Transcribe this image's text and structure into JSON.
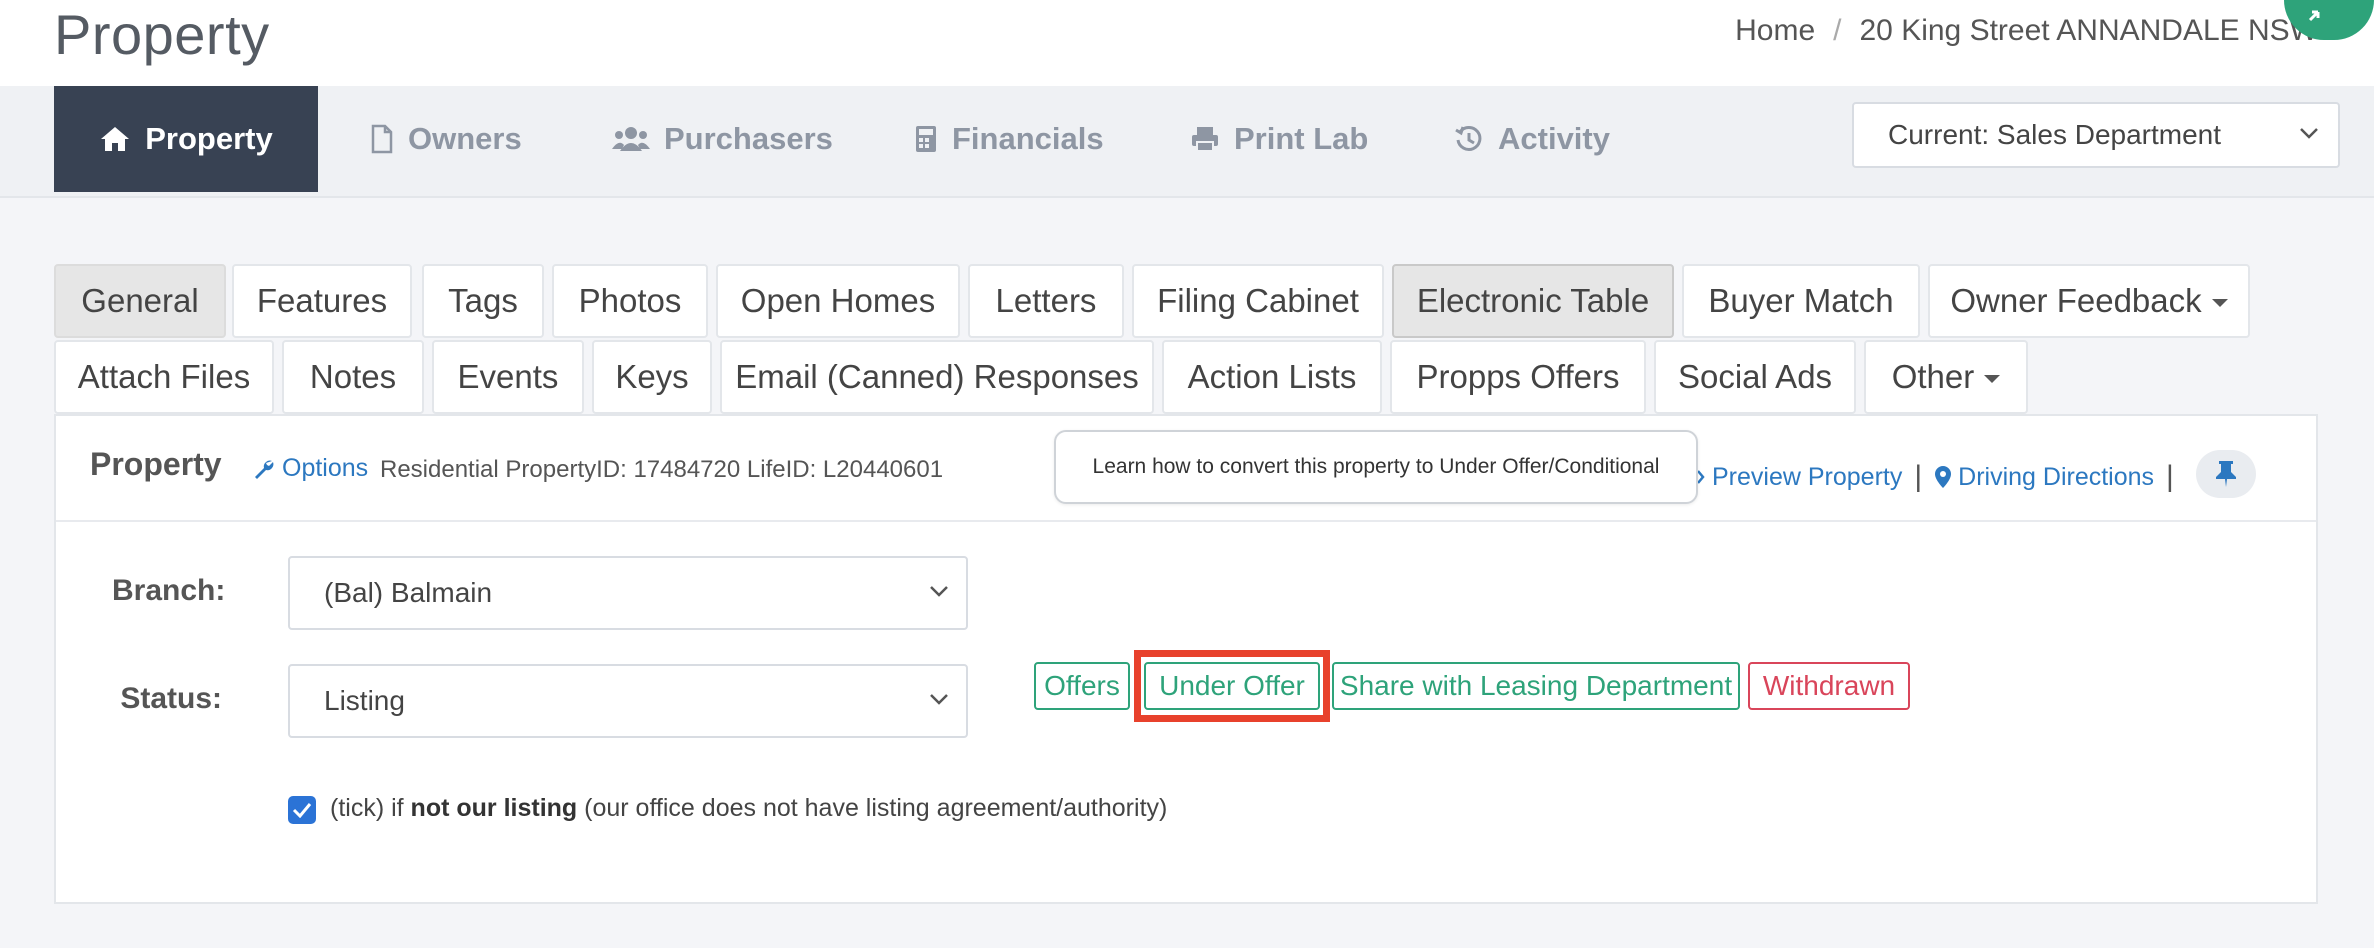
{
  "header": {
    "title": "Property",
    "breadcrumb": {
      "home": "Home",
      "separator": "/",
      "current": "20 King Street ANNANDALE NSW"
    }
  },
  "mainnav": {
    "items": [
      {
        "label": "Property",
        "icon": "home-icon",
        "active": true
      },
      {
        "label": "Owners",
        "icon": "file-icon"
      },
      {
        "label": "Purchasers",
        "icon": "users-icon"
      },
      {
        "label": "Financials",
        "icon": "calculator-icon"
      },
      {
        "label": "Print Lab",
        "icon": "print-icon"
      },
      {
        "label": "Activity",
        "icon": "history-icon"
      }
    ],
    "department": "Current: Sales Department"
  },
  "subtabs": {
    "row1": [
      "General",
      "Features",
      "Tags",
      "Photos",
      "Open Homes",
      "Letters",
      "Filing Cabinet",
      "Electronic Table",
      "Buyer Match",
      "Owner Feedback"
    ],
    "row2": [
      "Attach Files",
      "Notes",
      "Events",
      "Keys",
      "Email (Canned) Responses",
      "Action Lists",
      "Propps Offers",
      "Social Ads",
      "Other"
    ]
  },
  "panel": {
    "title": "Property",
    "options": "Options",
    "meta": "Residential PropertyID: 17484720 LifeID: L20440601",
    "tooltip": "Learn how to convert this property to Under Offer/Conditional",
    "preview": "Preview Property",
    "directions": "Driving Directions",
    "separator": "|"
  },
  "form": {
    "branch_label": "Branch:",
    "branch_value": "(Bal) Balmain",
    "status_label": "Status:",
    "status_value": "Listing",
    "status_buttons": {
      "offers": "Offers",
      "under_offer": "Under Offer",
      "share": "Share with Leasing Department",
      "withdrawn": "Withdrawn"
    },
    "not_listing": {
      "checked": true,
      "prefix": "(tick) if ",
      "bold": "not our listing",
      "suffix": " (our office does not have listing agreement/authority)"
    }
  },
  "colors": {
    "nav_active": "#384253",
    "accent_green": "#2ea37a",
    "danger_red": "#d9455a",
    "link_blue": "#2c78c0",
    "highlight": "#e8412c"
  }
}
